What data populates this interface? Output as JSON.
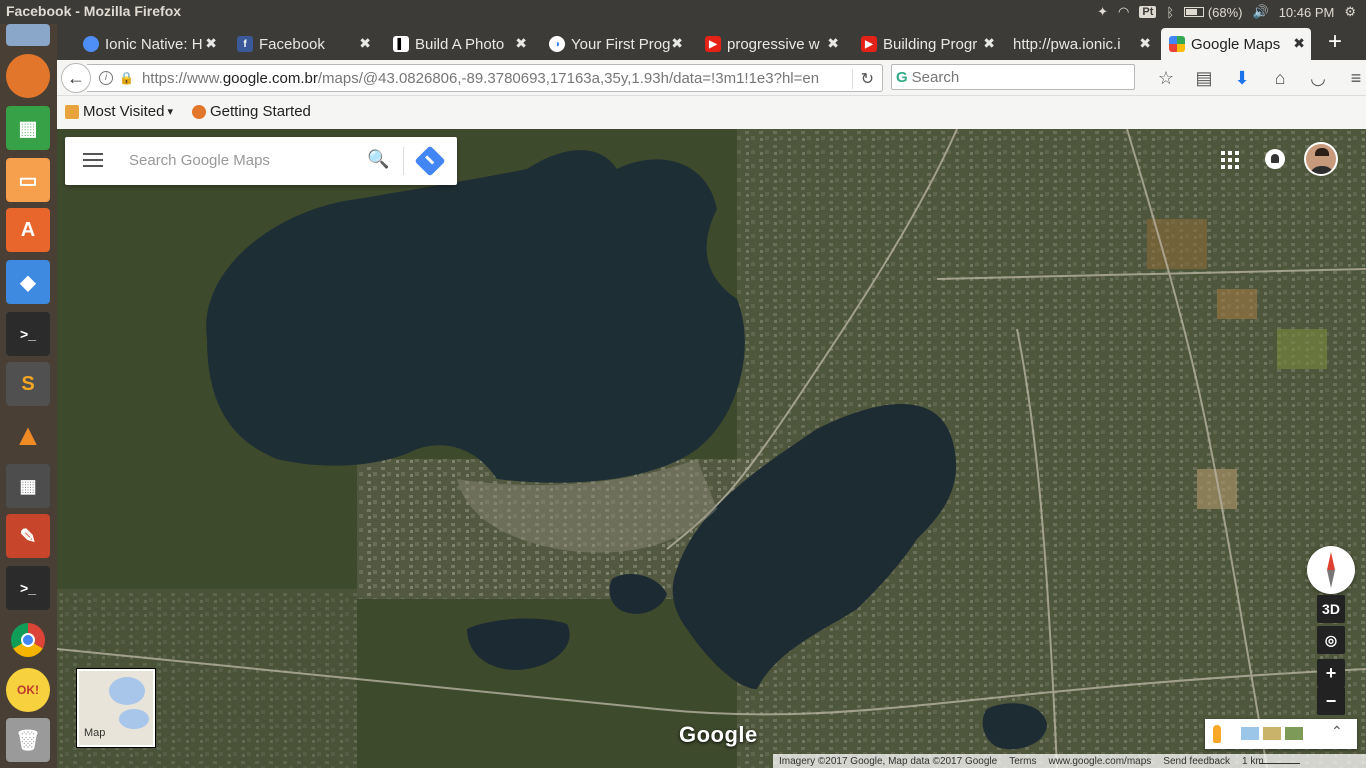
{
  "window": {
    "title": "Facebook - Mozilla Firefox"
  },
  "tray": {
    "ime": "Pt",
    "battery": "(68%)",
    "clock": "10:46 PM"
  },
  "launcher": [
    "files-icon",
    "firefox-icon",
    "calc-icon",
    "impress-icon",
    "software-center-icon",
    "dropbox-icon",
    "terminal-icon",
    "sublime-icon",
    "vlc-icon",
    "calculator-icon",
    "settings-icon",
    "terminal2-icon",
    "chrome-icon",
    "ok-icon",
    "trash-icon"
  ],
  "tabs": [
    {
      "label": "Ionic Native: H",
      "icon": "ionic-icon"
    },
    {
      "label": "Facebook",
      "icon": "facebook-icon"
    },
    {
      "label": "Build A Photo",
      "icon": "medium-icon"
    },
    {
      "label": "Your First Prog",
      "icon": "google-dev-icon"
    },
    {
      "label": "progressive w",
      "icon": "youtube-icon"
    },
    {
      "label": "Building Progr",
      "icon": "youtube-icon"
    },
    {
      "label": "http://pwa.ionic.i",
      "icon": ""
    },
    {
      "label": "Google Maps",
      "icon": "google-maps-icon",
      "active": true
    }
  ],
  "nav": {
    "url_prefix": "https://www.",
    "url_domain": "google.com.br",
    "url_rest": "/maps/@43.0826806,-89.3780693,17163a,35y,1.93h/data=!3m1!1e3?hl=en",
    "search_placeholder": "Search"
  },
  "bookmarks": {
    "most_visited": "Most Visited",
    "getting_started": "Getting Started"
  },
  "maps": {
    "search_placeholder": "Search Google Maps",
    "compass_ne": "3D",
    "zoom_in": "+",
    "zoom_out": "−",
    "minimap_label": "Map",
    "logo": "Google",
    "footer": {
      "imagery": "Imagery ©2017 Google, Map data ©2017 Google",
      "terms": "Terms",
      "site": "www.google.com/maps",
      "feedback": "Send feedback",
      "scale": "1 km"
    }
  }
}
